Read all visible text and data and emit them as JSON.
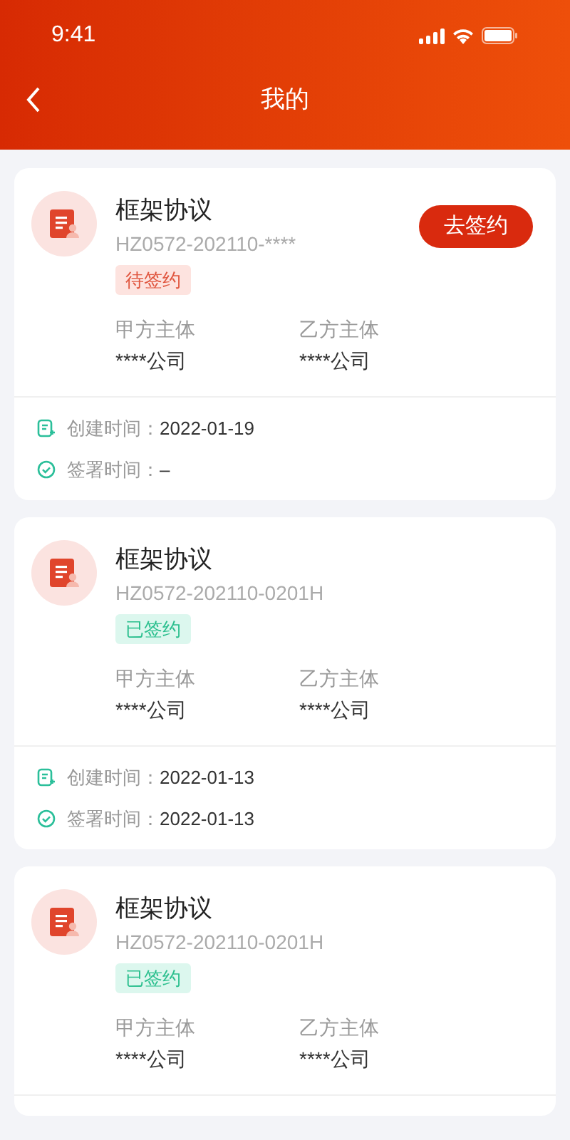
{
  "status_bar": {
    "time": "9:41"
  },
  "header": {
    "title": "我的"
  },
  "contracts": [
    {
      "title": "框架协议",
      "number": "HZ0572-202110-****",
      "status": {
        "kind": "pending",
        "label": "待签约"
      },
      "action": "去签约",
      "party_a": {
        "label": "甲方主体",
        "value": "****公司"
      },
      "party_b": {
        "label": "乙方主体",
        "value": "****公司"
      },
      "created": {
        "label": "创建时间：",
        "value": "2022-01-19"
      },
      "signed": {
        "label": "签署时间：",
        "value": "–"
      }
    },
    {
      "title": "框架协议",
      "number": "HZ0572-202110-0201H",
      "status": {
        "kind": "signed",
        "label": "已签约"
      },
      "party_a": {
        "label": "甲方主体",
        "value": "****公司"
      },
      "party_b": {
        "label": "乙方主体",
        "value": "****公司"
      },
      "created": {
        "label": "创建时间：",
        "value": "2022-01-13"
      },
      "signed": {
        "label": "签署时间：",
        "value": "2022-01-13"
      }
    },
    {
      "title": "框架协议",
      "number": "HZ0572-202110-0201H",
      "status": {
        "kind": "signed",
        "label": "已签约"
      },
      "party_a": {
        "label": "甲方主体",
        "value": "****公司"
      },
      "party_b": {
        "label": "乙方主体",
        "value": "****公司"
      }
    }
  ]
}
